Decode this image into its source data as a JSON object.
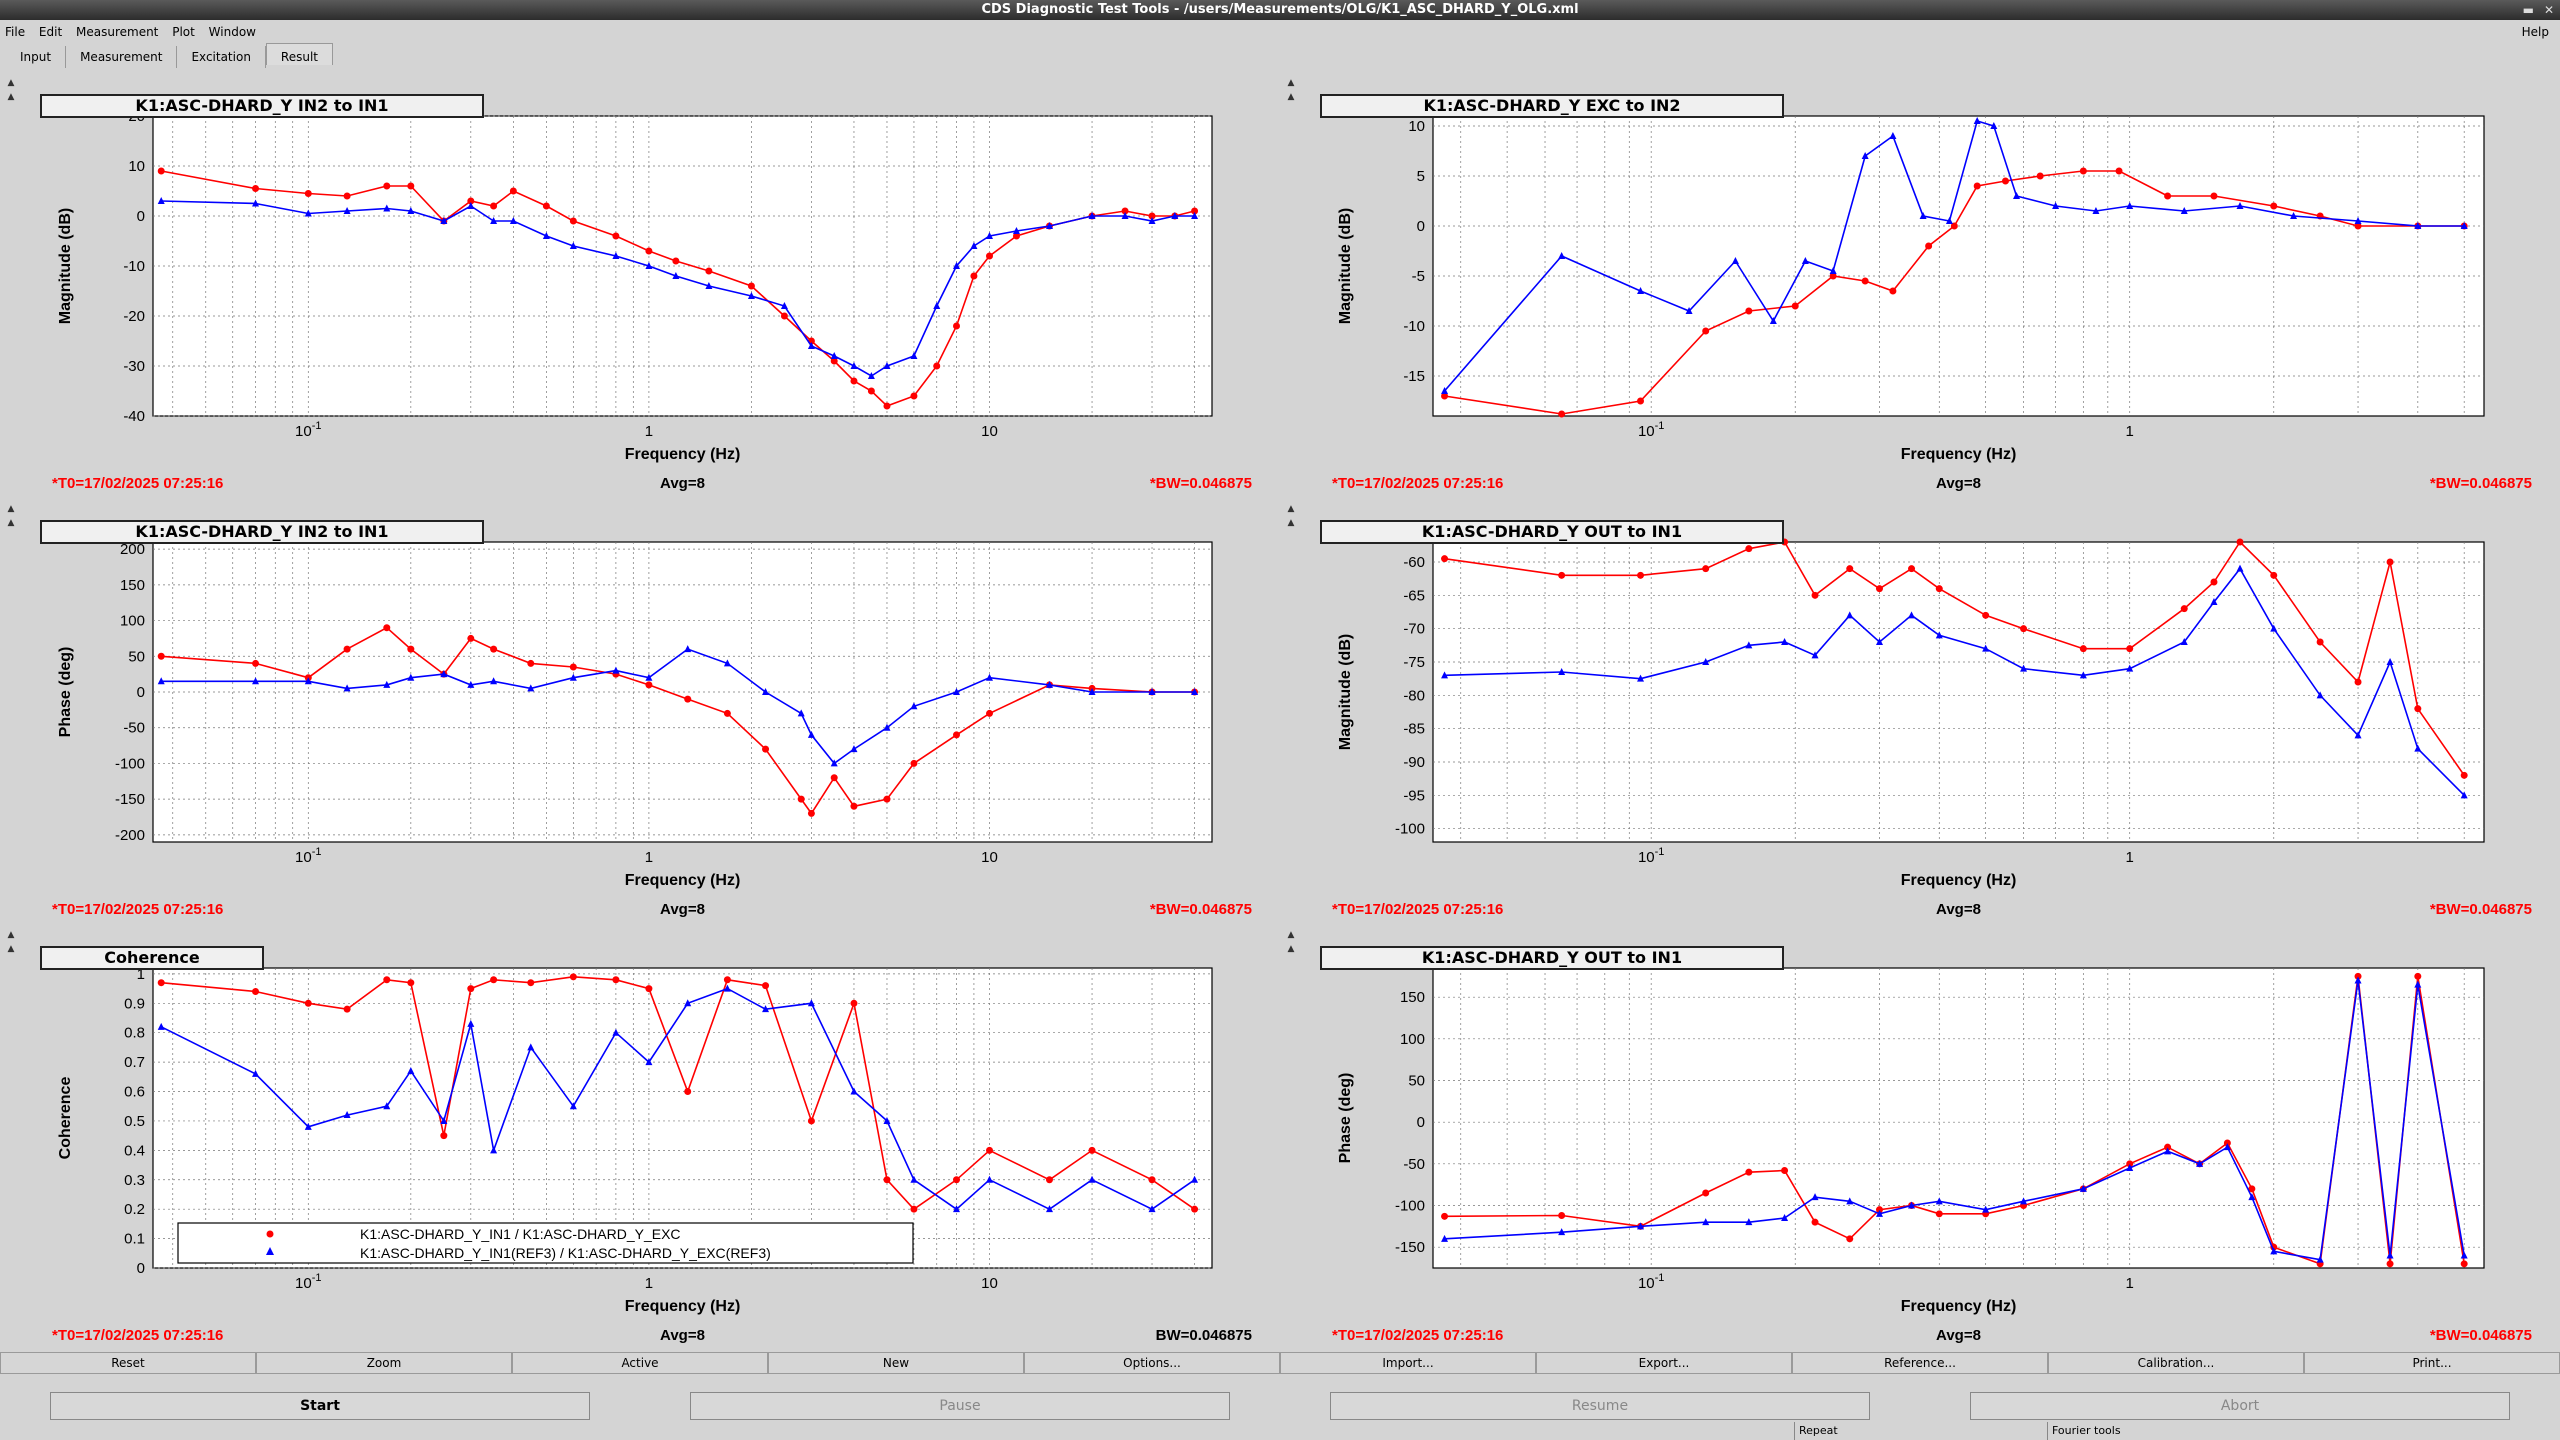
{
  "window": {
    "title": "CDS Diagnostic Test Tools - /users/Measurements/OLG/K1_ASC_DHARD_Y_OLG.xml"
  },
  "menu": {
    "file": "File",
    "edit": "Edit",
    "measurement": "Measurement",
    "plot": "Plot",
    "window": "Window",
    "help": "Help"
  },
  "tabs": [
    "Input",
    "Measurement",
    "Excitation",
    "Result"
  ],
  "active_tab": "Result",
  "colors": {
    "series_live": "#ff0000",
    "series_ref": "#0000ff",
    "status_red": "#ff0000"
  },
  "panels": [
    {
      "title": "K1:ASC-DHARD_Y IN2 to IN1",
      "ylabel": "Magnitude (dB)",
      "xlabel": "Frequency (Hz)",
      "t0": "*T0=17/02/2025 07:25:16",
      "avg": "Avg=8",
      "bw": "*BW=0.046875"
    },
    {
      "title": "K1:ASC-DHARD_Y EXC to IN2",
      "ylabel": "Magnitude (dB)",
      "xlabel": "Frequency (Hz)",
      "t0": "*T0=17/02/2025 07:25:16",
      "avg": "Avg=8",
      "bw": "*BW=0.046875"
    },
    {
      "title": "K1:ASC-DHARD_Y IN2 to IN1",
      "ylabel": "Phase (deg)",
      "xlabel": "Frequency (Hz)",
      "t0": "*T0=17/02/2025 07:25:16",
      "avg": "Avg=8",
      "bw": "*BW=0.046875"
    },
    {
      "title": "K1:ASC-DHARD_Y OUT to IN1",
      "ylabel": "Magnitude (dB)",
      "xlabel": "Frequency (Hz)",
      "t0": "*T0=17/02/2025 07:25:16",
      "avg": "Avg=8",
      "bw": "*BW=0.046875"
    },
    {
      "title": "Coherence",
      "ylabel": "Coherence",
      "xlabel": "Frequency (Hz)",
      "t0": "*T0=17/02/2025 07:25:16",
      "avg": "Avg=8",
      "bw": "BW=0.046875"
    },
    {
      "title": "K1:ASC-DHARD_Y OUT to IN1",
      "ylabel": "Phase (deg)",
      "xlabel": "Frequency (Hz)",
      "t0": "*T0=17/02/2025 07:25:16",
      "avg": "Avg=8",
      "bw": "*BW=0.046875"
    }
  ],
  "chart_data": [
    {
      "type": "line",
      "xscale": "log",
      "xlim": [
        0.035,
        45
      ],
      "ylim": [
        -40,
        20
      ],
      "yticks": [
        20,
        10,
        0,
        -10,
        -20,
        -30,
        -40
      ],
      "xticks": [
        {
          "v": 0.1,
          "label": "10^-1"
        },
        {
          "v": 1,
          "label": "1"
        },
        {
          "v": 10,
          "label": "10"
        }
      ],
      "series": [
        {
          "color": "red",
          "x": [
            0.037,
            0.07,
            0.1,
            0.13,
            0.17,
            0.2,
            0.25,
            0.3,
            0.35,
            0.4,
            0.5,
            0.6,
            0.8,
            1,
            1.2,
            1.5,
            2,
            2.5,
            3,
            3.5,
            4,
            4.5,
            5,
            6,
            7,
            8,
            9,
            10,
            12,
            15,
            20,
            25,
            30,
            35,
            40
          ],
          "y": [
            9,
            5.5,
            4.5,
            4,
            6,
            6,
            -1,
            3,
            2,
            5,
            2,
            -1,
            -4,
            -7,
            -9,
            -11,
            -14,
            -20,
            -25,
            -29,
            -33,
            -35,
            -38,
            -36,
            -30,
            -22,
            -12,
            -8,
            -4,
            -2,
            0,
            1,
            0,
            0,
            1
          ]
        },
        {
          "color": "blue",
          "x": [
            0.037,
            0.07,
            0.1,
            0.13,
            0.17,
            0.2,
            0.25,
            0.3,
            0.35,
            0.4,
            0.5,
            0.6,
            0.8,
            1,
            1.2,
            1.5,
            2,
            2.5,
            3,
            3.5,
            4,
            4.5,
            5,
            6,
            7,
            8,
            9,
            10,
            12,
            15,
            20,
            25,
            30,
            35,
            40
          ],
          "y": [
            3,
            2.5,
            0.5,
            1,
            1.5,
            1,
            -1,
            2,
            -1,
            -1,
            -4,
            -6,
            -8,
            -10,
            -12,
            -14,
            -16,
            -18,
            -26,
            -28,
            -30,
            -32,
            -30,
            -28,
            -18,
            -10,
            -6,
            -4,
            -3,
            -2,
            0,
            0,
            -1,
            0,
            0
          ]
        }
      ]
    },
    {
      "type": "line",
      "xscale": "log",
      "xlim": [
        0.035,
        5.5
      ],
      "ylim": [
        -19,
        11
      ],
      "yticks": [
        10,
        5,
        0,
        -5,
        -10,
        -15
      ],
      "xticks": [
        {
          "v": 0.1,
          "label": "10^-1"
        },
        {
          "v": 1,
          "label": "1"
        }
      ],
      "series": [
        {
          "color": "red",
          "x": [
            0.037,
            0.065,
            0.095,
            0.13,
            0.16,
            0.2,
            0.24,
            0.28,
            0.32,
            0.38,
            0.43,
            0.48,
            0.55,
            0.65,
            0.8,
            0.95,
            1.2,
            1.5,
            2,
            2.5,
            3,
            4,
            5
          ],
          "y": [
            -17,
            -18.8,
            -17.5,
            -10.5,
            -8.5,
            -8,
            -5,
            -5.5,
            -6.5,
            -2,
            0,
            4,
            4.5,
            5,
            5.5,
            5.5,
            3,
            3,
            2,
            1,
            0,
            0,
            0
          ]
        },
        {
          "color": "blue",
          "x": [
            0.037,
            0.065,
            0.095,
            0.12,
            0.15,
            0.18,
            0.21,
            0.24,
            0.28,
            0.32,
            0.37,
            0.42,
            0.48,
            0.52,
            0.58,
            0.7,
            0.85,
            1,
            1.3,
            1.7,
            2.2,
            3,
            4,
            5
          ],
          "y": [
            -16.5,
            -3,
            -6.5,
            -8.5,
            -3.5,
            -9.5,
            -3.5,
            -4.5,
            7,
            9,
            1,
            0.5,
            10.5,
            10,
            3,
            2,
            1.5,
            2,
            1.5,
            2,
            1,
            0.5,
            0,
            0
          ]
        }
      ]
    },
    {
      "type": "line",
      "xscale": "log",
      "xlim": [
        0.035,
        45
      ],
      "ylim": [
        -210,
        210
      ],
      "yticks": [
        200,
        150,
        100,
        50,
        0,
        -50,
        -100,
        -150,
        -200
      ],
      "xticks": [
        {
          "v": 0.1,
          "label": "10^-1"
        },
        {
          "v": 1,
          "label": "1"
        },
        {
          "v": 10,
          "label": "10"
        }
      ],
      "series": [
        {
          "color": "red",
          "x": [
            0.037,
            0.07,
            0.1,
            0.13,
            0.17,
            0.2,
            0.25,
            0.3,
            0.35,
            0.45,
            0.6,
            0.8,
            1,
            1.3,
            1.7,
            2.2,
            2.8,
            3,
            3.5,
            4,
            5,
            6,
            8,
            10,
            15,
            20,
            30,
            40
          ],
          "y": [
            50,
            40,
            20,
            60,
            90,
            60,
            25,
            75,
            60,
            40,
            35,
            25,
            10,
            -10,
            -30,
            -80,
            -150,
            -170,
            -120,
            -160,
            -150,
            -100,
            -60,
            -30,
            10,
            5,
            0,
            0
          ]
        },
        {
          "color": "blue",
          "x": [
            0.037,
            0.07,
            0.1,
            0.13,
            0.17,
            0.2,
            0.25,
            0.3,
            0.35,
            0.45,
            0.6,
            0.8,
            1,
            1.3,
            1.7,
            2.2,
            2.8,
            3,
            3.5,
            4,
            5,
            6,
            8,
            10,
            15,
            20,
            30,
            40
          ],
          "y": [
            15,
            15,
            15,
            5,
            10,
            20,
            25,
            10,
            15,
            5,
            20,
            30,
            20,
            60,
            40,
            0,
            -30,
            -60,
            -100,
            -80,
            -50,
            -20,
            0,
            20,
            10,
            0,
            0,
            0
          ]
        }
      ]
    },
    {
      "type": "line",
      "xscale": "log",
      "xlim": [
        0.035,
        5.5
      ],
      "ylim": [
        -102,
        -57
      ],
      "yticks": [
        -60,
        -65,
        -70,
        -75,
        -80,
        -85,
        -90,
        -95,
        -100
      ],
      "xticks": [
        {
          "v": 0.1,
          "label": "10^-1"
        },
        {
          "v": 1,
          "label": "1"
        }
      ],
      "series": [
        {
          "color": "red",
          "x": [
            0.037,
            0.065,
            0.095,
            0.13,
            0.16,
            0.19,
            0.22,
            0.26,
            0.3,
            0.35,
            0.4,
            0.5,
            0.6,
            0.8,
            1,
            1.3,
            1.5,
            1.7,
            2,
            2.5,
            3,
            3.5,
            4,
            5
          ],
          "y": [
            -59.5,
            -62,
            -62,
            -61,
            -58,
            -57,
            -65,
            -61,
            -64,
            -61,
            -64,
            -68,
            -70,
            -73,
            -73,
            -67,
            -63,
            -57,
            -62,
            -72,
            -78,
            -60,
            -82,
            -92
          ]
        },
        {
          "color": "blue",
          "x": [
            0.037,
            0.065,
            0.095,
            0.13,
            0.16,
            0.19,
            0.22,
            0.26,
            0.3,
            0.35,
            0.4,
            0.5,
            0.6,
            0.8,
            1,
            1.3,
            1.5,
            1.7,
            2,
            2.5,
            3,
            3.5,
            4,
            5
          ],
          "y": [
            -77,
            -76.5,
            -77.5,
            -75,
            -72.5,
            -72,
            -74,
            -68,
            -72,
            -68,
            -71,
            -73,
            -76,
            -77,
            -76,
            -72,
            -66,
            -61,
            -70,
            -80,
            -86,
            -75,
            -88,
            -95
          ]
        }
      ]
    },
    {
      "type": "line",
      "xscale": "log",
      "xlim": [
        0.035,
        45
      ],
      "ylim": [
        0,
        1.02
      ],
      "yticks": [
        1,
        0.9,
        0.8,
        0.7,
        0.6,
        0.5,
        0.4,
        0.3,
        0.2,
        0.1,
        0
      ],
      "xticks": [
        {
          "v": 0.1,
          "label": "10^-1"
        },
        {
          "v": 1,
          "label": "1"
        },
        {
          "v": 10,
          "label": "10"
        }
      ],
      "legend": [
        "K1:ASC-DHARD_Y_IN1 / K1:ASC-DHARD_Y_EXC",
        "K1:ASC-DHARD_Y_IN1(REF3) / K1:ASC-DHARD_Y_EXC(REF3)"
      ],
      "series": [
        {
          "color": "red",
          "name": "K1:ASC-DHARD_Y_IN1 / K1:ASC-DHARD_Y_EXC",
          "x": [
            0.037,
            0.07,
            0.1,
            0.13,
            0.17,
            0.2,
            0.25,
            0.3,
            0.35,
            0.45,
            0.6,
            0.8,
            1,
            1.3,
            1.7,
            2.2,
            3,
            4,
            5,
            6,
            8,
            10,
            15,
            20,
            30,
            40
          ],
          "y": [
            0.97,
            0.94,
            0.9,
            0.88,
            0.98,
            0.97,
            0.45,
            0.95,
            0.98,
            0.97,
            0.99,
            0.98,
            0.95,
            0.6,
            0.98,
            0.96,
            0.5,
            0.9,
            0.3,
            0.2,
            0.3,
            0.4,
            0.3,
            0.4,
            0.3,
            0.2
          ]
        },
        {
          "color": "blue",
          "name": "K1:ASC-DHARD_Y_IN1(REF3) / K1:ASC-DHARD_Y_EXC(REF3)",
          "x": [
            0.037,
            0.07,
            0.1,
            0.13,
            0.17,
            0.2,
            0.25,
            0.3,
            0.35,
            0.45,
            0.6,
            0.8,
            1,
            1.3,
            1.7,
            2.2,
            3,
            4,
            5,
            6,
            8,
            10,
            15,
            20,
            30,
            40
          ],
          "y": [
            0.82,
            0.66,
            0.48,
            0.52,
            0.55,
            0.67,
            0.5,
            0.83,
            0.4,
            0.75,
            0.55,
            0.8,
            0.7,
            0.9,
            0.95,
            0.88,
            0.9,
            0.6,
            0.5,
            0.3,
            0.2,
            0.3,
            0.2,
            0.3,
            0.2,
            0.3
          ]
        }
      ]
    },
    {
      "type": "line",
      "xscale": "log",
      "xlim": [
        0.035,
        5.5
      ],
      "ylim": [
        -175,
        185
      ],
      "yticks": [
        150,
        100,
        50,
        0,
        -50,
        -100,
        -150
      ],
      "xticks": [
        {
          "v": 0.1,
          "label": "10^-1"
        },
        {
          "v": 1,
          "label": "1"
        }
      ],
      "series": [
        {
          "color": "red",
          "x": [
            0.037,
            0.065,
            0.095,
            0.13,
            0.16,
            0.19,
            0.22,
            0.26,
            0.3,
            0.35,
            0.4,
            0.5,
            0.6,
            0.8,
            1,
            1.2,
            1.4,
            1.6,
            1.8,
            2,
            2.5,
            3,
            3.5,
            4,
            5
          ],
          "y": [
            -113,
            -112,
            -125,
            -85,
            -60,
            -58,
            -120,
            -140,
            -105,
            -100,
            -110,
            -110,
            -100,
            -80,
            -50,
            -30,
            -50,
            -25,
            -80,
            -150,
            -170,
            175,
            -170,
            175,
            -170
          ]
        },
        {
          "color": "blue",
          "x": [
            0.037,
            0.065,
            0.095,
            0.13,
            0.16,
            0.19,
            0.22,
            0.26,
            0.3,
            0.35,
            0.4,
            0.5,
            0.6,
            0.8,
            1,
            1.2,
            1.4,
            1.6,
            1.8,
            2,
            2.5,
            3,
            3.5,
            4,
            5
          ],
          "y": [
            -140,
            -132,
            -125,
            -120,
            -120,
            -115,
            -90,
            -95,
            -110,
            -100,
            -95,
            -105,
            -95,
            -80,
            -55,
            -35,
            -50,
            -30,
            -90,
            -155,
            -165,
            170,
            -160,
            165,
            -160
          ]
        }
      ]
    }
  ],
  "buttons_row1": [
    "Reset",
    "Zoom",
    "Active",
    "New",
    "Options...",
    "Import...",
    "Export...",
    "Reference...",
    "Calibration...",
    "Print..."
  ],
  "buttons_row2": [
    "Start",
    "Pause",
    "Resume",
    "Abort"
  ],
  "status": [
    "Repeat",
    "Fourier tools"
  ]
}
